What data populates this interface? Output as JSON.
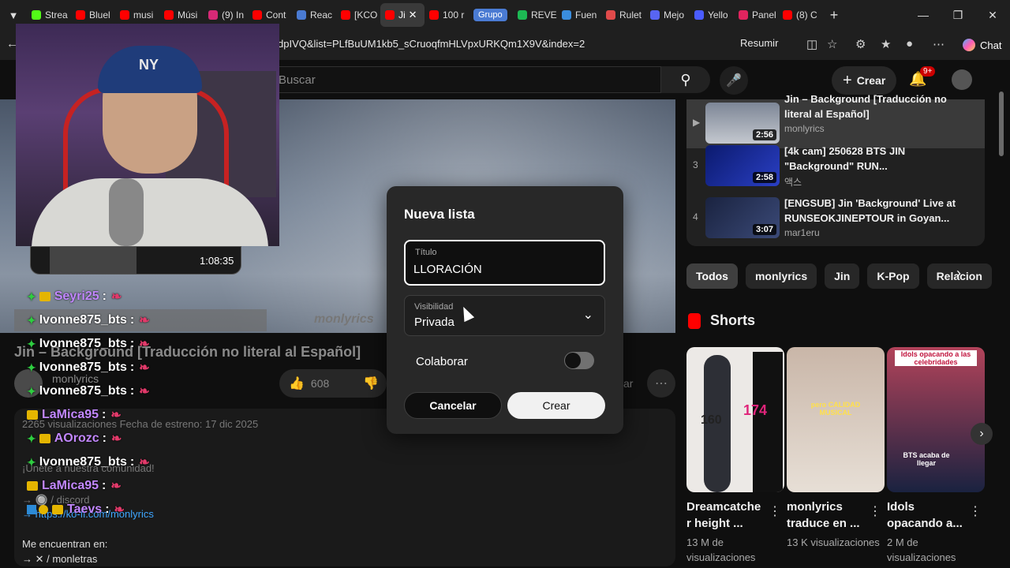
{
  "browser": {
    "tabs": [
      {
        "label": "Strea",
        "color": "#53fc18"
      },
      {
        "label": "Bluel",
        "color": "#ff0000"
      },
      {
        "label": "musi",
        "color": "#ff0000"
      },
      {
        "label": "Músi",
        "color": "#ff0000"
      },
      {
        "label": "(9) In",
        "color": "#d62976"
      },
      {
        "label": "Cont",
        "color": "#ff0000"
      },
      {
        "label": "Reac",
        "color": "#4a7bd3"
      },
      {
        "label": "[KCO",
        "color": "#ff0000"
      },
      {
        "label": "Ji",
        "color": "#ff0000",
        "active": true
      },
      {
        "label": "100 r",
        "color": "#ff0000"
      },
      {
        "label": "Grupo",
        "group": true
      },
      {
        "label": "REVE",
        "color": "#1db954"
      },
      {
        "label": "Fuen",
        "color": "#3a8dde"
      },
      {
        "label": "Rulet",
        "color": "#e04a4a"
      },
      {
        "label": "Mejo",
        "color": "#5865f2"
      },
      {
        "label": "Yello",
        "color": "#4a5cff"
      },
      {
        "label": "Panel",
        "color": "#e0245e"
      },
      {
        "label": "(8) C",
        "color": "#ff0000"
      }
    ],
    "url": "dpIVQ&list=PLfBuUM1kb5_sCruoqfmHLVpxURKQm1X9V&index=2",
    "resumir": "Resumir",
    "chat": "Chat"
  },
  "youtube": {
    "search_placeholder": "Buscar",
    "create_label": "Crear",
    "notif_badge": "9+"
  },
  "video": {
    "watermark": "monlyrics",
    "title": "Jin – Background [Traducción no literal al Español]",
    "channel": "monlyrics",
    "likes": "608",
    "share_fragment": "ar"
  },
  "description": {
    "stats": "2265 visualizaciones  Fecha de estreno: 17 dic 2025",
    "community": "¡Únete a nuestra comunidad!",
    "discord": "→ 🔘 / discord",
    "link": "→ https://ko-fi.com/monlyrics",
    "find_us": "Me encuentran en:",
    "monletras": "→ ✕ / monletras"
  },
  "playlist": [
    {
      "index": "▶",
      "title": "Jin – Background [Traducción no literal al Español]",
      "channel": "monlyrics",
      "duration": "2:56",
      "current": true
    },
    {
      "index": "3",
      "title": "[4k cam] 250628 BTS JIN \"Background\" RUN...",
      "channel": "액스",
      "duration": "2:58"
    },
    {
      "index": "4",
      "title": "[ENGSUB] Jin 'Background' Live at RUNSEOKJINEPTOUR in Goyan...",
      "channel": "mar1eru",
      "duration": "3:07"
    }
  ],
  "chips": [
    "Todos",
    "monlyrics",
    "Jin",
    "K-Pop",
    "Relacion"
  ],
  "shorts": {
    "header": "Shorts",
    "items": [
      {
        "title": "Dreamcatche r height ...",
        "views": "13 M de visualizaciones",
        "thumb_text": [
          "160",
          "174"
        ]
      },
      {
        "title": "monlyrics traduce en ...",
        "views": "13 K visualizaciones",
        "thumb_text": [
          "pero CALIDAD MUSICAL"
        ]
      },
      {
        "title": "Idols opacando a...",
        "views": "2 M de visualizaciones",
        "thumb_text": [
          "Idols opacando a las celebridades",
          "BTS acaba de llegar"
        ]
      }
    ]
  },
  "stream": {
    "timer": "1:08:35",
    "chat": [
      {
        "user": "Seyri25",
        "color": "#c287ff",
        "badges": [
          "diamond",
          "crown"
        ]
      },
      {
        "user": "Ivonne875_bts",
        "color": "#ffffff",
        "badges": [
          "diamond"
        ],
        "highlight": true
      },
      {
        "user": "Ivonne875_bts",
        "color": "#ffffff",
        "badges": [
          "diamond"
        ]
      },
      {
        "user": "Ivonne875_bts",
        "color": "#ffffff",
        "badges": [
          "diamond"
        ]
      },
      {
        "user": "Ivonne875_bts",
        "color": "#ffffff",
        "badges": [
          "diamond"
        ]
      },
      {
        "user": "LaMica95",
        "color": "#c287ff",
        "badges": [
          "crown"
        ]
      },
      {
        "user": "AOrozc",
        "color": "#c287ff",
        "badges": [
          "diamond",
          "crown"
        ]
      },
      {
        "user": "Ivonne875_bts",
        "color": "#ffffff",
        "badges": [
          "diamond"
        ]
      },
      {
        "user": "LaMica95",
        "color": "#c287ff",
        "badges": [
          "crown"
        ]
      },
      {
        "user": "Taevs",
        "color": "#c287ff",
        "badges": [
          "cube",
          "coin",
          "crown"
        ]
      }
    ]
  },
  "modal": {
    "title": "Nueva lista",
    "title_label": "Título",
    "title_value": "LLORACIÓN ",
    "visibility_label": "Visibilidad",
    "visibility_value": "Privada",
    "collab_label": "Colaborar",
    "collab_on": false,
    "cancel": "Cancelar",
    "create": "Crear"
  }
}
